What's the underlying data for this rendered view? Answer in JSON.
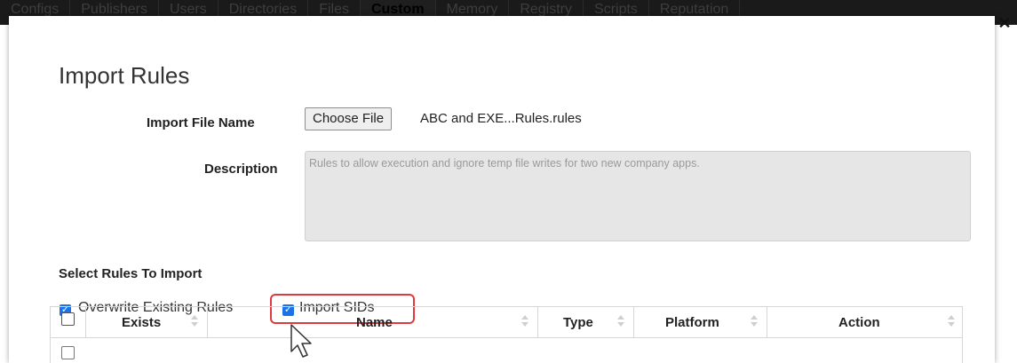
{
  "nav": {
    "tabs": [
      "Configs",
      "Publishers",
      "Users",
      "Directories",
      "Files",
      "Custom",
      "Memory",
      "Registry",
      "Scripts",
      "Reputation"
    ],
    "active_tab": "Custom"
  },
  "modal": {
    "title": "Import Rules",
    "import_file_label": "Import File Name",
    "choose_file_button": "Choose File",
    "file_name": "ABC and EXE...Rules.rules",
    "description_label": "Description",
    "description_value": "Rules to allow execution and ignore temp file writes for two new company apps.",
    "select_rules_title": "Select Rules To Import",
    "overwrite_label": "Overwrite Existing Rules",
    "overwrite_checked": true,
    "import_sids_label": "Import SIDs",
    "import_sids_checked": true
  },
  "table": {
    "columns": [
      "Exists",
      "Name",
      "Type",
      "Platform",
      "Action"
    ]
  },
  "colors": {
    "accent_checkbox": "#1a73e8",
    "highlight_border": "#e0393e"
  }
}
